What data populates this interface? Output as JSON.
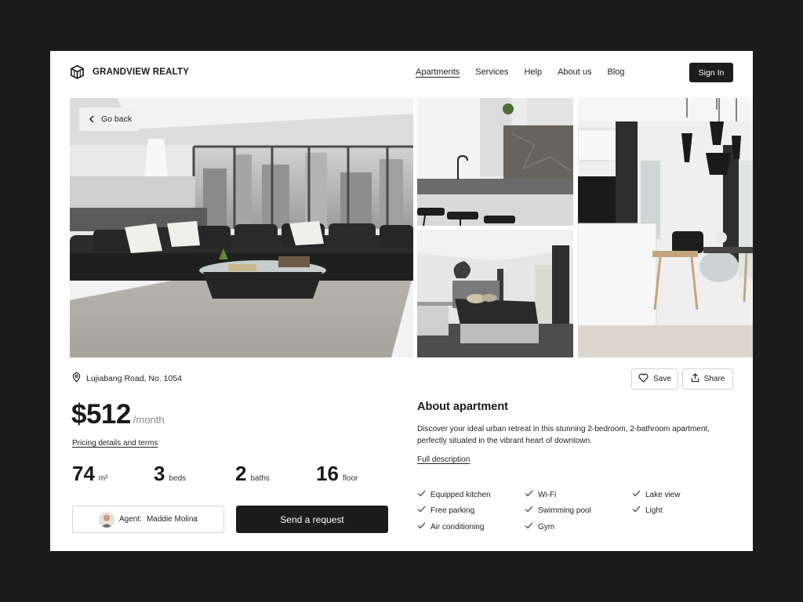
{
  "brand": {
    "name": "GRANDVIEW REALTY",
    "logo_icon": "cube-logo-icon"
  },
  "nav": {
    "items": [
      {
        "label": "Apartments",
        "active": true
      },
      {
        "label": "Services"
      },
      {
        "label": "Help"
      },
      {
        "label": "About us"
      },
      {
        "label": "Blog"
      }
    ],
    "signin_label": "Sign In"
  },
  "gallery": {
    "back_label": "Go back",
    "photos": [
      "living-room-photo",
      "kitchen-photo",
      "bedroom-photo",
      "dining-room-photo"
    ]
  },
  "listing": {
    "address": "Lujiabang Road, No. 1054",
    "price": "$512",
    "price_period": "/month",
    "pricing_link": "Pricing details and terms",
    "stats": [
      {
        "value": "74",
        "unit": "m²"
      },
      {
        "value": "3",
        "unit": "beds"
      },
      {
        "value": "2",
        "unit": "baths"
      },
      {
        "value": "16",
        "unit": "floor"
      }
    ],
    "agent_prefix": "Agent:",
    "agent_name": "Maddie Molina",
    "request_label": "Send a request"
  },
  "actions": {
    "save_label": "Save",
    "share_label": "Share"
  },
  "about": {
    "title": "About apartment",
    "description": "Discover your ideal urban retreat in this stunning 2-bedroom, 2-bathroom apartment, perfectly situated in the vibrant heart of downtown.",
    "full_link": "Full description",
    "amenities": [
      [
        "Equipped kitchen",
        "Free parking",
        "Air conditioning"
      ],
      [
        "Wi-Fi",
        "Swimming pool",
        "Gym"
      ],
      [
        "Lake view",
        "Light"
      ]
    ]
  },
  "colors": {
    "background": "#1c1c1c",
    "card": "#ffffff",
    "primary": "#1c1c1c",
    "muted": "#888888",
    "border": "#d4d4d4"
  }
}
